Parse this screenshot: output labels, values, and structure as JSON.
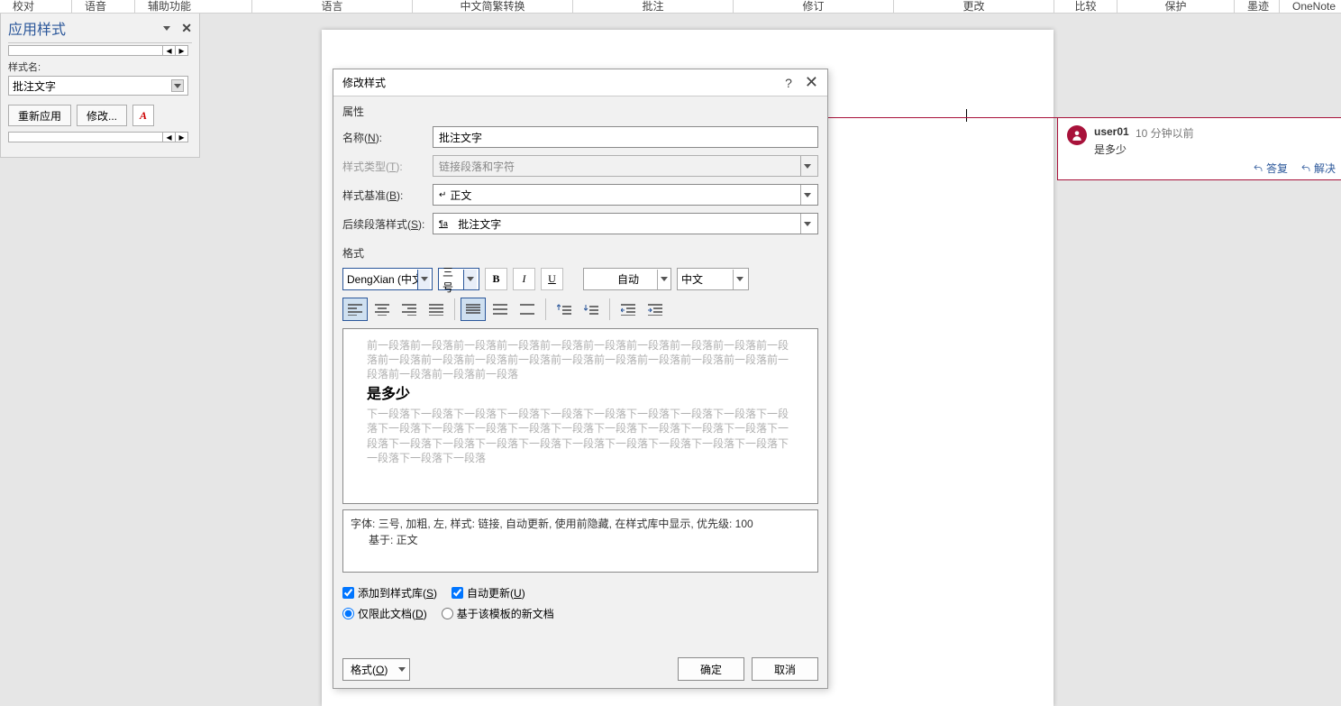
{
  "ribbon": {
    "items": [
      "校对",
      "语音",
      "辅助功能",
      "语言",
      "中文简繁转换",
      "批注",
      "修订",
      "更改",
      "比较",
      "保护",
      "墨迹",
      "OneNote"
    ]
  },
  "sidepanel": {
    "title": "应用样式",
    "label": "样式名:",
    "value": "批注文字",
    "reapply": "重新应用",
    "modify": "修改..."
  },
  "comment": {
    "user": "user01",
    "time": "10 分钟以前",
    "text": "是多少",
    "reply": "答复",
    "resolve": "解决"
  },
  "dialog": {
    "title": "修改样式",
    "section_props": "属性",
    "name_label": "名称",
    "name_hot": "N",
    "name_val": "批注文字",
    "type_label": "样式类型",
    "type_hot": "T",
    "type_val": "链接段落和字符",
    "base_label": "样式基准",
    "base_hot": "B",
    "base_val": "正文",
    "next_label": "后续段落样式",
    "next_hot": "S",
    "next_val": "批注文字",
    "section_fmt": "格式",
    "font": "DengXian (中文",
    "size": "三号",
    "autocolor": "自动",
    "lang": "中文",
    "preview_before": "前一段落前一段落前一段落前一段落前一段落前一段落前一段落前一段落前一段落前一段落前一段落前一段落前一段落前一段落前一段落前一段落前一段落前一段落前一段落前一段落前一段落前一段落前一段落",
    "preview_sample": "是多少",
    "preview_after": "下一段落下一段落下一段落下一段落下一段落下一段落下一段落下一段落下一段落下一段落下一段落下一段落下一段落下一段落下一段落下一段落下一段落下一段落下一段落下一段落下一段落下一段落下一段落下一段落下一段落下一段落下一段落下一段落下一段落下一段落下一段落下一段落",
    "desc_line1": "字体: 三号, 加粗, 左, 样式: 链接, 自动更新, 使用前隐藏, 在样式库中显示, 优先级: 100",
    "desc_line2": "基于: 正文",
    "chk_add": "添加到样式库",
    "chk_add_hot": "S",
    "chk_auto": "自动更新",
    "chk_auto_hot": "U",
    "radio_doc": "仅限此文档",
    "radio_doc_hot": "D",
    "radio_tmpl": "基于该模板的新文档",
    "format_btn": "格式",
    "format_hot": "O",
    "ok": "确定",
    "cancel": "取消"
  }
}
